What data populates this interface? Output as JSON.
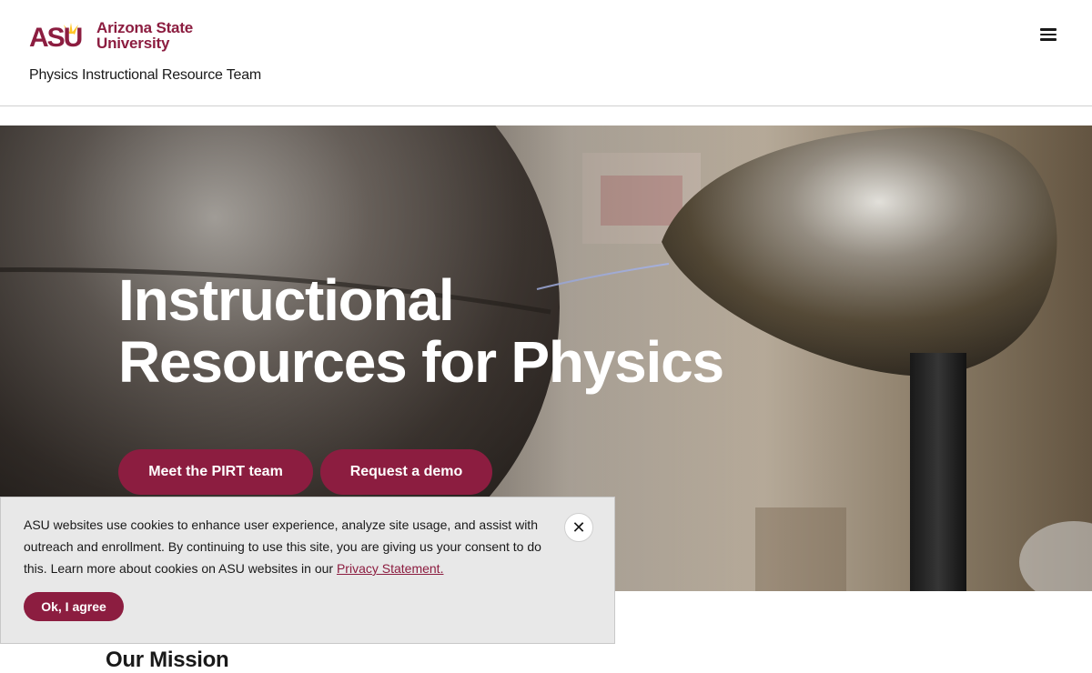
{
  "header": {
    "logo_acronym": "ASU",
    "logo_line1": "Arizona State",
    "logo_line2": "University",
    "site_title": "Physics Instructional Resource Team",
    "menu_icon": "hamburger-menu-icon"
  },
  "hero": {
    "title_line1": "Instructional",
    "title_line2": "Resources for Physics",
    "buttons": [
      {
        "label": "Meet the PIRT team"
      },
      {
        "label": "Request a demo"
      }
    ]
  },
  "cookie_banner": {
    "text": "ASU websites use cookies to enhance user experience, analyze site usage, and assist with outreach and enrollment. By continuing to use this site, you are giving us your consent to do this. Learn more about cookies on ASU websites in our ",
    "link_label": "Privacy Statement.",
    "agree_label": "Ok, I agree",
    "close_icon": "close-icon"
  },
  "mission": {
    "heading": "Our Mission"
  },
  "colors": {
    "brand_maroon": "#8c1d40",
    "brand_gold": "#ffc627"
  }
}
